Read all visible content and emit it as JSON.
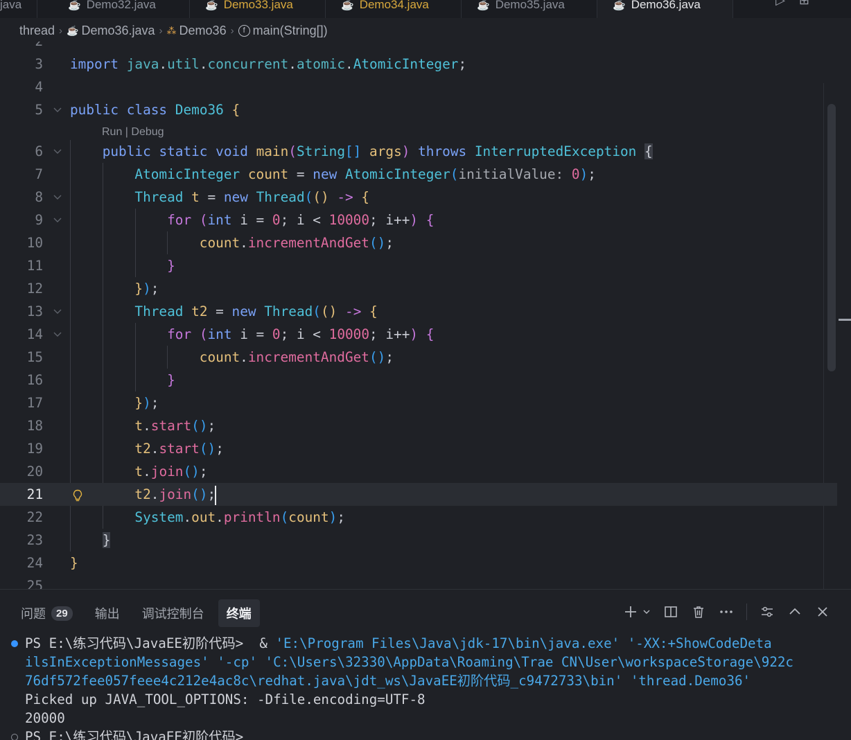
{
  "tabs": [
    {
      "label": "java",
      "state": "normal"
    },
    {
      "label": "Demo32.java",
      "state": "normal"
    },
    {
      "label": "Demo33.java",
      "state": "modified"
    },
    {
      "label": "Demo34.java",
      "state": "modified"
    },
    {
      "label": "Demo35.java",
      "state": "normal"
    },
    {
      "label": "Demo36.java",
      "state": "active"
    }
  ],
  "breadcrumb": {
    "folder": "thread",
    "file": "Demo36.java",
    "class": "Demo36",
    "method": "main(String[])"
  },
  "editor": {
    "lines": [
      {
        "n": "2",
        "tokens": []
      },
      {
        "n": "3",
        "tokens": [
          [
            "kw2",
            "import"
          ],
          [
            "pl",
            " "
          ],
          [
            "pkg",
            "java"
          ],
          [
            "pl",
            "."
          ],
          [
            "pkg",
            "util"
          ],
          [
            "pl",
            "."
          ],
          [
            "pkg",
            "concurrent"
          ],
          [
            "pl",
            "."
          ],
          [
            "pkg",
            "atomic"
          ],
          [
            "pl",
            "."
          ],
          [
            "cls",
            "AtomicInteger"
          ],
          [
            "pl",
            ";"
          ]
        ]
      },
      {
        "n": "4",
        "tokens": []
      },
      {
        "n": "5",
        "fold": true,
        "tokens": [
          [
            "kw2",
            "public"
          ],
          [
            "pl",
            " "
          ],
          [
            "kw2",
            "class"
          ],
          [
            "pl",
            " "
          ],
          [
            "cls",
            "Demo36"
          ],
          [
            "pl",
            " "
          ],
          [
            "br1",
            "{"
          ]
        ]
      },
      {
        "n": "6",
        "fold": true,
        "tokens": [
          [
            "pl",
            "    "
          ],
          [
            "kw2",
            "public"
          ],
          [
            "pl",
            " "
          ],
          [
            "kw2",
            "static"
          ],
          [
            "pl",
            " "
          ],
          [
            "kw2",
            "void"
          ],
          [
            "pl",
            " "
          ],
          [
            "var",
            "main"
          ],
          [
            "br2",
            "("
          ],
          [
            "cls",
            "String"
          ],
          [
            "br3",
            "[]"
          ],
          [
            "pl",
            " "
          ],
          [
            "var",
            "args"
          ],
          [
            "br2",
            ")"
          ],
          [
            "pl",
            " "
          ],
          [
            "kw2",
            "throws"
          ],
          [
            "pl",
            " "
          ],
          [
            "cls",
            "InterruptedException"
          ],
          [
            "pl",
            " "
          ],
          [
            "brhl",
            "{"
          ]
        ]
      },
      {
        "n": "7",
        "tokens": [
          [
            "pl",
            "        "
          ],
          [
            "cls",
            "AtomicInteger"
          ],
          [
            "pl",
            " "
          ],
          [
            "var",
            "count"
          ],
          [
            "pl",
            " = "
          ],
          [
            "kw2",
            "new"
          ],
          [
            "pl",
            " "
          ],
          [
            "cls",
            "AtomicInteger"
          ],
          [
            "br3",
            "("
          ],
          [
            "ph",
            "initialValue:"
          ],
          [
            "pl",
            " "
          ],
          [
            "num",
            "0"
          ],
          [
            "br3",
            ")"
          ],
          [
            "pl",
            ";"
          ]
        ]
      },
      {
        "n": "8",
        "fold": true,
        "tokens": [
          [
            "pl",
            "        "
          ],
          [
            "cls",
            "Thread"
          ],
          [
            "pl",
            " "
          ],
          [
            "var",
            "t"
          ],
          [
            "pl",
            " = "
          ],
          [
            "kw2",
            "new"
          ],
          [
            "pl",
            " "
          ],
          [
            "cls",
            "Thread"
          ],
          [
            "br3",
            "("
          ],
          [
            "br1",
            "()"
          ],
          [
            "pl",
            " "
          ],
          [
            "kw",
            "->"
          ],
          [
            "pl",
            " "
          ],
          [
            "br1",
            "{"
          ]
        ]
      },
      {
        "n": "9",
        "fold": true,
        "tokens": [
          [
            "pl",
            "            "
          ],
          [
            "kw",
            "for"
          ],
          [
            "pl",
            " "
          ],
          [
            "br2",
            "("
          ],
          [
            "kw2",
            "int"
          ],
          [
            "pl",
            " i = "
          ],
          [
            "num",
            "0"
          ],
          [
            "pl",
            "; i < "
          ],
          [
            "num",
            "10000"
          ],
          [
            "pl",
            "; i++"
          ],
          [
            "br2",
            ")"
          ],
          [
            "pl",
            " "
          ],
          [
            "br2",
            "{"
          ]
        ]
      },
      {
        "n": "10",
        "tokens": [
          [
            "pl",
            "                "
          ],
          [
            "var",
            "count"
          ],
          [
            "pl",
            "."
          ],
          [
            "fn",
            "incrementAndGet"
          ],
          [
            "br3",
            "()"
          ],
          [
            "pl",
            ";"
          ]
        ]
      },
      {
        "n": "11",
        "tokens": [
          [
            "pl",
            "            "
          ],
          [
            "br2",
            "}"
          ]
        ]
      },
      {
        "n": "12",
        "tokens": [
          [
            "pl",
            "        "
          ],
          [
            "br1",
            "}"
          ],
          [
            "br3",
            ")"
          ],
          [
            "pl",
            ";"
          ]
        ]
      },
      {
        "n": "13",
        "fold": true,
        "tokens": [
          [
            "pl",
            "        "
          ],
          [
            "cls",
            "Thread"
          ],
          [
            "pl",
            " "
          ],
          [
            "var",
            "t2"
          ],
          [
            "pl",
            " = "
          ],
          [
            "kw2",
            "new"
          ],
          [
            "pl",
            " "
          ],
          [
            "cls",
            "Thread"
          ],
          [
            "br3",
            "("
          ],
          [
            "br1",
            "()"
          ],
          [
            "pl",
            " "
          ],
          [
            "kw",
            "->"
          ],
          [
            "pl",
            " "
          ],
          [
            "br1",
            "{"
          ]
        ]
      },
      {
        "n": "14",
        "fold": true,
        "tokens": [
          [
            "pl",
            "            "
          ],
          [
            "kw",
            "for"
          ],
          [
            "pl",
            " "
          ],
          [
            "br2",
            "("
          ],
          [
            "kw2",
            "int"
          ],
          [
            "pl",
            " i = "
          ],
          [
            "num",
            "0"
          ],
          [
            "pl",
            "; i < "
          ],
          [
            "num",
            "10000"
          ],
          [
            "pl",
            "; i++"
          ],
          [
            "br2",
            ")"
          ],
          [
            "pl",
            " "
          ],
          [
            "br2",
            "{"
          ]
        ]
      },
      {
        "n": "15",
        "tokens": [
          [
            "pl",
            "                "
          ],
          [
            "var",
            "count"
          ],
          [
            "pl",
            "."
          ],
          [
            "fn",
            "incrementAndGet"
          ],
          [
            "br3",
            "()"
          ],
          [
            "pl",
            ";"
          ]
        ]
      },
      {
        "n": "16",
        "tokens": [
          [
            "pl",
            "            "
          ],
          [
            "br2",
            "}"
          ]
        ]
      },
      {
        "n": "17",
        "tokens": [
          [
            "pl",
            "        "
          ],
          [
            "br1",
            "}"
          ],
          [
            "br3",
            ")"
          ],
          [
            "pl",
            ";"
          ]
        ]
      },
      {
        "n": "18",
        "tokens": [
          [
            "pl",
            "        "
          ],
          [
            "var",
            "t"
          ],
          [
            "pl",
            "."
          ],
          [
            "fn",
            "start"
          ],
          [
            "br3",
            "()"
          ],
          [
            "pl",
            ";"
          ]
        ]
      },
      {
        "n": "19",
        "tokens": [
          [
            "pl",
            "        "
          ],
          [
            "var",
            "t2"
          ],
          [
            "pl",
            "."
          ],
          [
            "fn",
            "start"
          ],
          [
            "br3",
            "()"
          ],
          [
            "pl",
            ";"
          ]
        ]
      },
      {
        "n": "20",
        "tokens": [
          [
            "pl",
            "        "
          ],
          [
            "var",
            "t"
          ],
          [
            "pl",
            "."
          ],
          [
            "fn",
            "join"
          ],
          [
            "br3",
            "()"
          ],
          [
            "pl",
            ";"
          ]
        ]
      },
      {
        "n": "21",
        "current": true,
        "tokens": [
          [
            "pl",
            "        "
          ],
          [
            "var",
            "t2"
          ],
          [
            "pl",
            "."
          ],
          [
            "fn",
            "join"
          ],
          [
            "br3",
            "()"
          ],
          [
            "pl",
            ";"
          ]
        ]
      },
      {
        "n": "22",
        "tokens": [
          [
            "pl",
            "        "
          ],
          [
            "cls",
            "System"
          ],
          [
            "pl",
            "."
          ],
          [
            "var",
            "out"
          ],
          [
            "pl",
            "."
          ],
          [
            "fn",
            "println"
          ],
          [
            "br3",
            "("
          ],
          [
            "var",
            "count"
          ],
          [
            "br3",
            ")"
          ],
          [
            "pl",
            ";"
          ]
        ]
      },
      {
        "n": "23",
        "tokens": [
          [
            "pl",
            "    "
          ],
          [
            "brhl",
            "}"
          ]
        ]
      },
      {
        "n": "24",
        "tokens": [
          [
            "br1",
            "}"
          ]
        ]
      },
      {
        "n": "25",
        "tokens": []
      }
    ],
    "codelens": "Run | Debug"
  },
  "panel": {
    "tabs": [
      {
        "label": "问题",
        "badge": "29"
      },
      {
        "label": "输出"
      },
      {
        "label": "调试控制台"
      },
      {
        "label": "终端",
        "active": true
      }
    ],
    "actions": [
      "add-icon",
      "chevron-down-icon",
      "split-icon",
      "trash-icon",
      "more-icon",
      "settings-sliders-icon",
      "maximize-icon",
      "close-icon"
    ]
  },
  "terminal": {
    "lines": [
      {
        "text": "PS E:\\练习代码\\JavaEE初阶代码>  & ",
        "cmd": "'E:\\Program Files\\Java\\jdk-17\\bin\\java.exe' '-XX:+ShowCodeDeta",
        "dot": "blue"
      },
      {
        "text": "",
        "cmd": "ilsInExceptionMessages' '-cp' 'C:\\Users\\32330\\AppData\\Roaming\\Trae CN\\User\\workspaceStorage\\922c"
      },
      {
        "text": "",
        "cmd": "76df572fee057feee4c212e4ac8c\\redhat.java\\jdt_ws\\JavaEE初阶代码_c9472733\\bin' 'thread.Demo36'"
      },
      {
        "text": "Picked up JAVA_TOOL_OPTIONS: -Dfile.encoding=UTF-8",
        "cmd": ""
      },
      {
        "text": "20000",
        "cmd": ""
      },
      {
        "text": "PS E:\\练习代码\\JavaEE初阶代码>",
        "cmd": "",
        "dot": "ring"
      }
    ]
  }
}
